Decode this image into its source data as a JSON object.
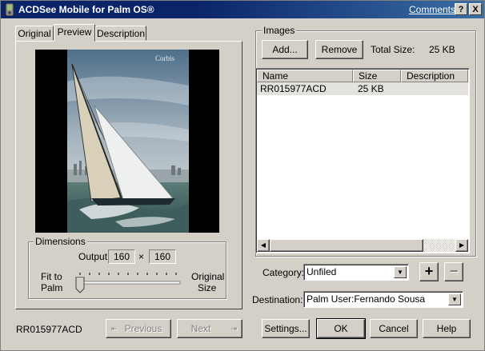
{
  "window": {
    "title": "ACDSee Mobile for Palm OS®",
    "comments_link": "Comments?",
    "help_button": "?",
    "close_button": "X"
  },
  "tabs": [
    "Original",
    "Preview",
    "Description"
  ],
  "preview": {
    "watermark": "Corbis"
  },
  "dimensions": {
    "group_label": "Dimensions",
    "output_label": "Output:",
    "width": "160",
    "times": "×",
    "height": "160",
    "fit_label_1": "Fit to",
    "fit_label_2": "Palm",
    "orig_label_1": "Original",
    "orig_label_2": "Size",
    "slider_position": 0
  },
  "images": {
    "group_label": "Images",
    "add_button": "Add...",
    "remove_button": "Remove",
    "total_size_label": "Total Size:",
    "total_size_value": "25 KB",
    "columns": [
      "Name",
      "Size",
      "Description"
    ],
    "rows": [
      {
        "name": "RR015977ACD",
        "size": "25 KB",
        "description": ""
      }
    ]
  },
  "category": {
    "label": "Category:",
    "value": "Unfiled",
    "add_button": "+",
    "remove_button": "−"
  },
  "destination": {
    "label": "Destination:",
    "value": "Palm User:Fernando Sousa"
  },
  "footer": {
    "filename": "RR015977ACD",
    "previous_button": "Previous",
    "next_button": "Next",
    "settings_button": "Settings...",
    "ok_button": "OK",
    "cancel_button": "Cancel",
    "help_button": "Help"
  }
}
